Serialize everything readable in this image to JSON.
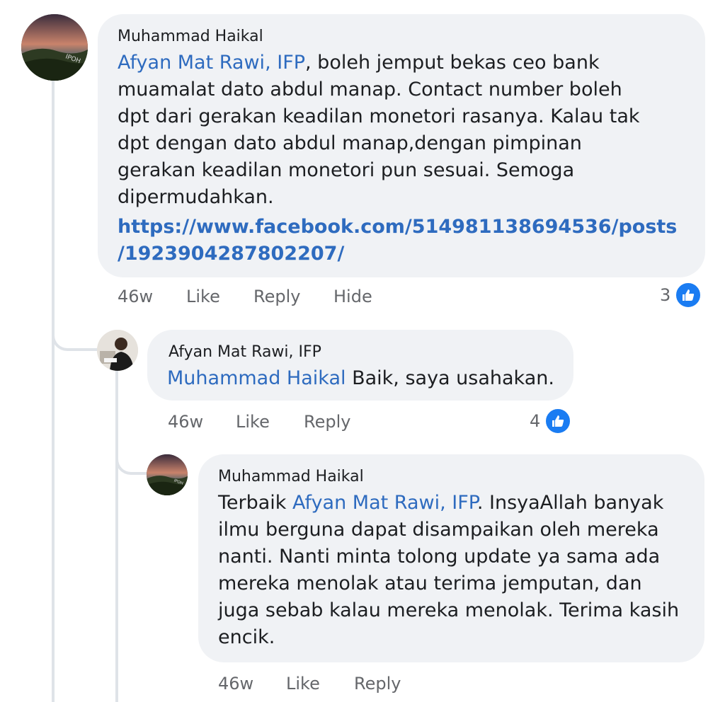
{
  "comments": [
    {
      "author": "Muhammad Haikal",
      "mention": "Afyan Mat Rawi, IFP",
      "text": ", boleh jemput bekas ceo bank muamalat dato abdul manap. Contact number boleh dpt dari gerakan keadilan monetori rasanya. Kalau tak dpt dengan dato abdul manap,dengan pimpinan gerakan keadilan monetori pun sesuai. Semoga dipermudahkan.",
      "link_line1": "https://www.facebook.com/514981138694536/posts",
      "link_line2": "/1923904287802207/",
      "time": "46w",
      "like_label": "Like",
      "reply_label": "Reply",
      "hide_label": "Hide",
      "reactions": "3"
    },
    {
      "author": "Afyan Mat Rawi, IFP",
      "mention": "Muhammad Haikal",
      "text": " Baik, saya usahakan.",
      "time": "46w",
      "like_label": "Like",
      "reply_label": "Reply",
      "reactions": "4"
    },
    {
      "author": "Muhammad Haikal",
      "text_before": "Terbaik ",
      "mention": "Afyan Mat Rawi, IFP",
      "text": ". InsyaAllah banyak ilmu berguna dapat disampaikan oleh mereka nanti. Nanti minta tolong update ya sama ada mereka menolak atau terima jemputan, dan juga sebab kalau mereka menolak. Terima kasih encik.",
      "time": "46w",
      "like_label": "Like",
      "reply_label": "Reply"
    }
  ],
  "colors": {
    "bubble": "#f0f2f5",
    "mention": "#2e6bbf",
    "like_badge": "#1a7cf2",
    "meta": "#65676b"
  },
  "icons": {
    "reaction": "thumbs-up-icon"
  }
}
